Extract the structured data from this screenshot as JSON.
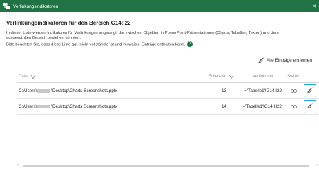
{
  "window": {
    "title": "Verlinkungsindikatoren",
    "close_glyph": "✕"
  },
  "heading": "Verlinkungsindikatoren für den Bereich G14:I22",
  "description": {
    "line1": "In dieser Liste werden Indikatoren für Verlinkungen angezeigt, die zwischen Objekten in PowerPoint-Präsentationen (Charts, Tabellen, Texten) und dem",
    "line2": "ausgewählten Bereich bestehen könnten.",
    "line3": "Bitte beachten Sie, dass diese Liste ggf. nicht vollständig ist und verwaiste Einträge enthalten kann.",
    "help_glyph": "?"
  },
  "remove_all_label": "Alle Einträge entfernen",
  "table": {
    "columns": {
      "file": "Datei",
      "slide_no": "Folien-Nr.",
      "linked_with": "Verlinkt mit",
      "status": "Status"
    },
    "rows": [
      {
        "path_prefix": "C:\\Users\\",
        "path_suffix": "\\Desktop\\Charts Screenshots.pptx",
        "slide": "13",
        "linked_with": "='Tabelle1'!G14:I22",
        "status_icon": "link-icon"
      },
      {
        "path_prefix": "C:\\Users\\",
        "path_suffix": "\\Desktop\\Charts Screenshots.pptx",
        "slide": "14",
        "linked_with": "='Tabelle1'!G14:H22",
        "status_icon": "link-icon"
      }
    ]
  },
  "scrollbar": {
    "left_arrow": "‹",
    "right_arrow": "›"
  },
  "colors": {
    "titlebar": "#217346",
    "highlight": "#1ca3dd"
  }
}
